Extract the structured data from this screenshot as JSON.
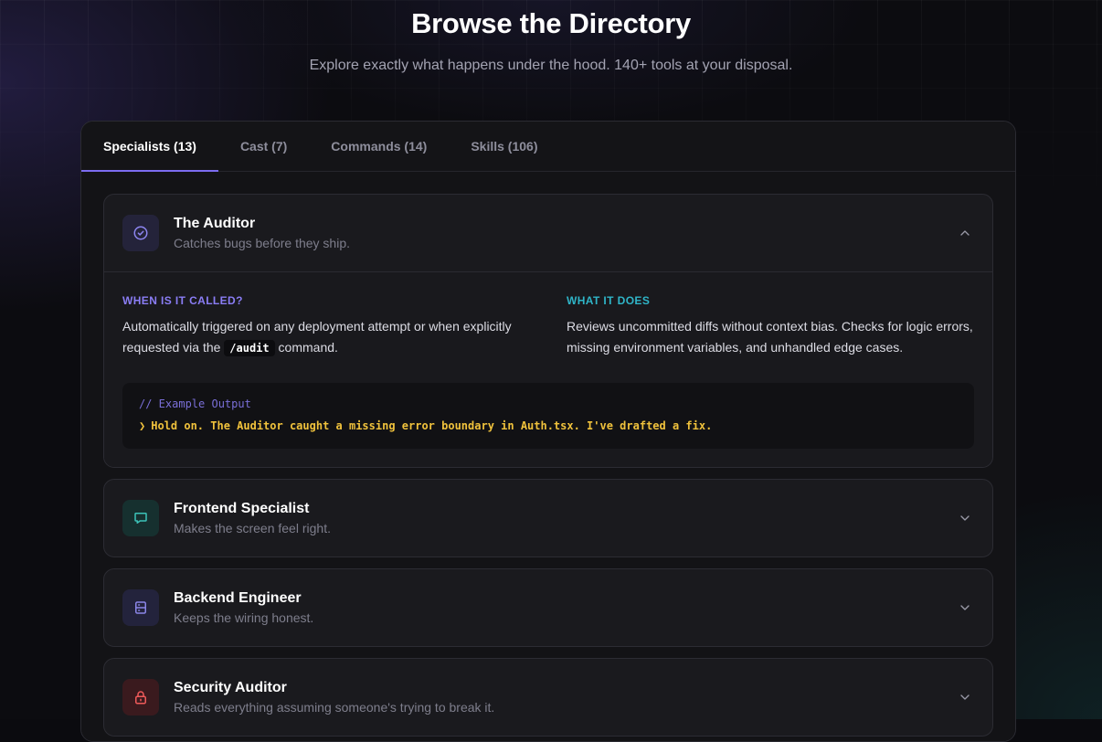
{
  "header": {
    "title": "Browse the Directory",
    "subtitle": "Explore exactly what happens under the hood. 140+ tools at your disposal."
  },
  "tabs": [
    {
      "label": "Specialists (13)",
      "active": true
    },
    {
      "label": "Cast (7)",
      "active": false
    },
    {
      "label": "Commands (14)",
      "active": false
    },
    {
      "label": "Skills (106)",
      "active": false
    }
  ],
  "cards": [
    {
      "title": "The Auditor",
      "subtitle": "Catches bugs before they ship.",
      "icon": "check-circle-icon",
      "expanded": true,
      "when_label": "WHEN IS IT CALLED?",
      "when_text_before": "Automatically triggered on any deployment attempt or when explicitly requested via the ",
      "when_code": "/audit",
      "when_text_after": " command.",
      "what_label": "WHAT IT DOES",
      "what_text": "Reviews uncommitted diffs without context bias. Checks for logic errors, missing environment variables, and unhandled edge cases.",
      "output_comment": "// Example Output",
      "output_prompt": "❯",
      "output_line": "Hold on. The Auditor caught a missing error boundary in Auth.tsx. I've drafted a fix."
    },
    {
      "title": "Frontend Specialist",
      "subtitle": "Makes the screen feel right.",
      "icon": "message-square-icon",
      "expanded": false
    },
    {
      "title": "Backend Engineer",
      "subtitle": "Keeps the wiring honest.",
      "icon": "server-icon",
      "expanded": false
    },
    {
      "title": "Security Auditor",
      "subtitle": "Reads everything assuming someone's trying to break it.",
      "icon": "lock-icon",
      "expanded": false
    }
  ],
  "colors": {
    "accent": "#7c6cf0",
    "label_purple": "#8a7df5",
    "label_teal": "#2fb5c8",
    "terminal_text": "#f0c23c"
  }
}
